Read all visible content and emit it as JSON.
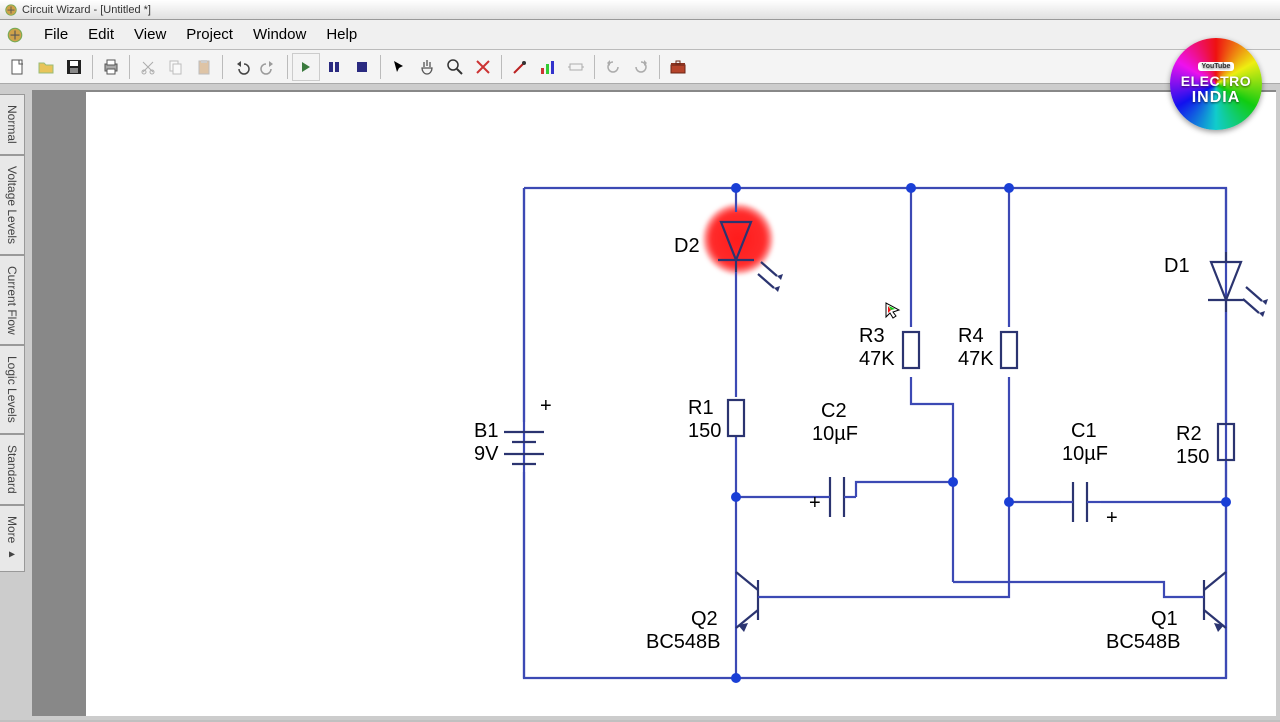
{
  "window": {
    "title": "Circuit Wizard - [Untitled *]"
  },
  "menu": {
    "file": "File",
    "edit": "Edit",
    "view": "View",
    "project": "Project",
    "window": "Window",
    "help": "Help"
  },
  "side_tabs": {
    "normal": "Normal",
    "voltage": "Voltage Levels",
    "current": "Current Flow",
    "logic": "Logic Levels",
    "standard": "Standard",
    "more": "More ▸"
  },
  "logo": {
    "tag": "YouTube",
    "line1": "ELECTRO",
    "line2": "INDIA"
  },
  "components": {
    "B1": {
      "ref": "B1",
      "val": "9V"
    },
    "D1": {
      "ref": "D1"
    },
    "D2": {
      "ref": "D2"
    },
    "R1": {
      "ref": "R1",
      "val": "150"
    },
    "R2": {
      "ref": "R2",
      "val": "150"
    },
    "R3": {
      "ref": "R3",
      "val": "47K"
    },
    "R4": {
      "ref": "R4",
      "val": "47K"
    },
    "C1": {
      "ref": "C1",
      "val": "10µF"
    },
    "C2": {
      "ref": "C2",
      "val": "10µF"
    },
    "Q1": {
      "ref": "Q1",
      "val": "BC548B"
    },
    "Q2": {
      "ref": "Q2",
      "val": "BC548B"
    }
  }
}
